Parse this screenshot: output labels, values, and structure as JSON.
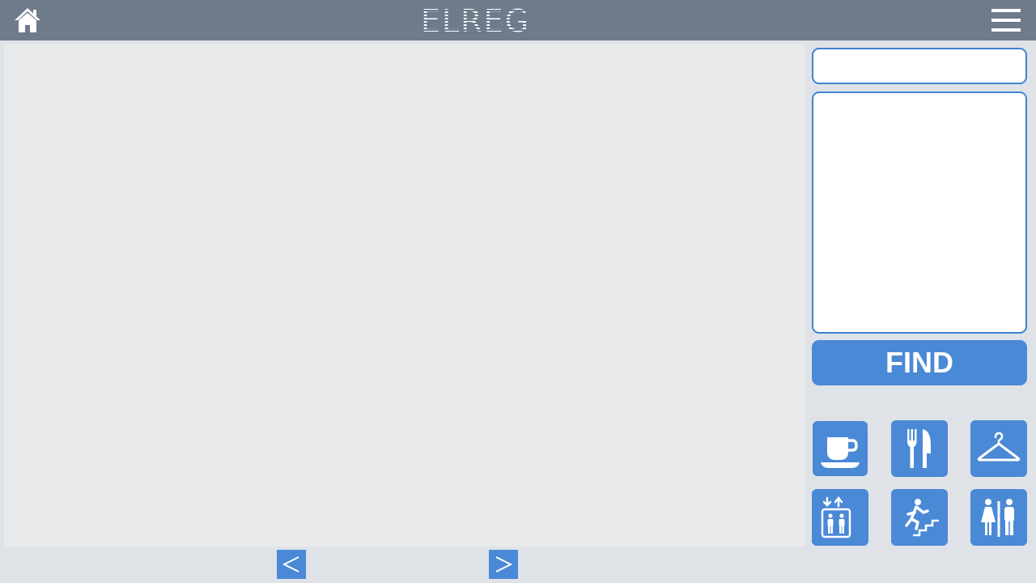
{
  "header": {
    "logo_text": "ELREG",
    "home_icon": "home-icon",
    "menu_icon": "hamburger-menu-icon",
    "bar_color": "#6e7b8b"
  },
  "search": {
    "value": "",
    "placeholder": ""
  },
  "find_button": {
    "label": "FIND"
  },
  "categories": [
    {
      "id": "cafe",
      "icon": "coffee-cup-icon"
    },
    {
      "id": "restaurant",
      "icon": "fork-knife-icon"
    },
    {
      "id": "clothing",
      "icon": "hanger-icon"
    },
    {
      "id": "elevator",
      "icon": "elevator-icon"
    },
    {
      "id": "stairs",
      "icon": "stairs-icon"
    },
    {
      "id": "restroom",
      "icon": "restroom-icon"
    }
  ],
  "pager": {
    "prev_label": "<",
    "next_label": ">"
  },
  "colors": {
    "accent": "#4a89d6",
    "border": "#3f83d1",
    "page_bg": "#dfe3e8",
    "map_bg": "#e9eaeb"
  }
}
